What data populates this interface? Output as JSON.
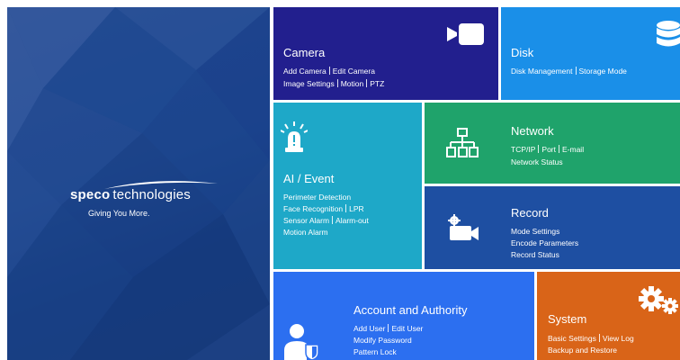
{
  "brand": {
    "name_bold": "speco",
    "name_light": "technologies",
    "tagline": "Giving You More."
  },
  "tiles": {
    "camera": {
      "title": "Camera",
      "lines": [
        [
          "Add Camera",
          "Edit Camera"
        ],
        [
          "Image Settings",
          "Motion",
          "PTZ"
        ]
      ],
      "icon": "video-camera-icon",
      "color": "#221f8e"
    },
    "disk": {
      "title": "Disk",
      "lines": [
        [
          "Disk Management",
          "Storage Mode"
        ]
      ],
      "icon": "database-icon",
      "color": "#1a8fe8"
    },
    "ai": {
      "title": "AI / Event",
      "lines": [
        [
          "Perimeter Detection"
        ],
        [
          "Face Recognition",
          "LPR"
        ],
        [
          "Sensor Alarm",
          "Alarm-out"
        ],
        [
          "Motion Alarm"
        ]
      ],
      "icon": "alarm-light-icon",
      "color": "#1ea8c8"
    },
    "network": {
      "title": "Network",
      "lines": [
        [
          "TCP/IP",
          "Port",
          "E-mail"
        ],
        [
          "Network Status"
        ]
      ],
      "icon": "network-tree-icon",
      "color": "#1fa36b"
    },
    "record": {
      "title": "Record",
      "lines": [
        [
          "Mode Settings"
        ],
        [
          "Encode Parameters"
        ],
        [
          "Record Status"
        ]
      ],
      "icon": "record-camera-gear-icon",
      "color": "#1e4fa2"
    },
    "account": {
      "title": "Account and Authority",
      "lines": [
        [
          "Add User",
          "Edit User"
        ],
        [
          "Modify Password"
        ],
        [
          "Pattern Lock"
        ]
      ],
      "icon": "user-shield-icon",
      "color": "#2c6ff0"
    },
    "system": {
      "title": "System",
      "lines": [
        [
          "Basic Settings",
          "View Log"
        ],
        [
          "Backup and Restore"
        ]
      ],
      "icon": "gears-icon",
      "color": "#d96418"
    }
  }
}
